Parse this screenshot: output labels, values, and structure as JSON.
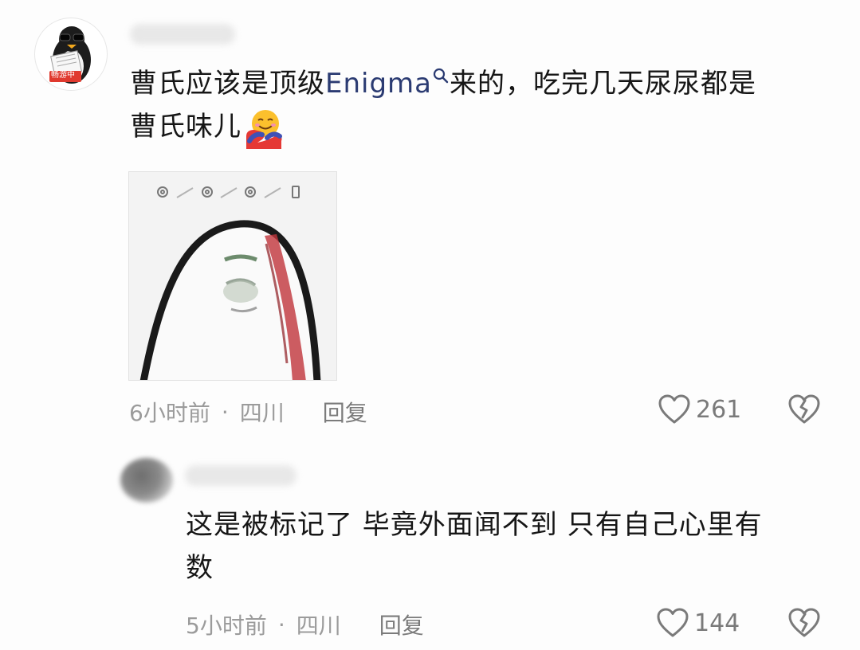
{
  "comments": [
    {
      "text_before_link": "曹氏应该是顶级",
      "link_text": "Enigma",
      "text_after_link": "来的，吃完几天尿尿都是",
      "text_line2": "曹氏味儿",
      "avatar_badge": "畅游中",
      "time": "6小时前",
      "location": "四川",
      "reply_label": "回复",
      "likes": "261"
    },
    {
      "text_line1": "这是被标记了 毕竟外面闻不到 只有自己心里有",
      "text_line2": "数",
      "time": "5小时前",
      "location": "四川",
      "reply_label": "回复",
      "likes": "144"
    }
  ],
  "icons": {
    "like": "heart-outline-icon",
    "dislike": "broken-heart-icon",
    "search": "search-icon",
    "emoji": "hugging-face-emoji"
  },
  "colors": {
    "link": "#2b3b72",
    "meta": "#9b9b9b",
    "badge": "#e03a2f"
  }
}
